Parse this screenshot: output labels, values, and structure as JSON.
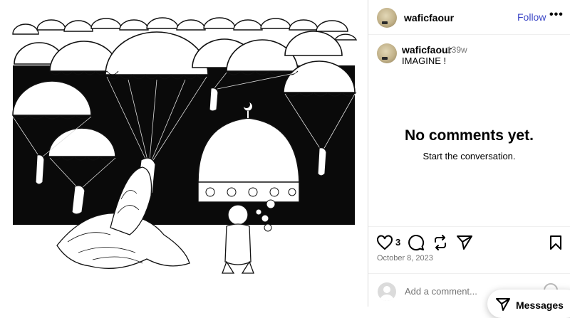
{
  "post": {
    "username": "waficfaour",
    "follow_label": "Follow",
    "more_label": "•••",
    "caption_username": "waficfaour",
    "time_ago": "139w",
    "caption_text": "IMAGINE !",
    "likes_count": "3",
    "date": "October 8, 2023",
    "image_alt": "cartoon of soldiers parachuting toward a dome while a child watches"
  },
  "comments": {
    "empty_title": "No comments yet.",
    "empty_subtitle": "Start the conversation.",
    "add_placeholder": "Add a comment..."
  },
  "messages": {
    "label": "Messages"
  },
  "colors": {
    "accent": "#3c47c7",
    "muted": "#737373",
    "border": "#dbdbdb"
  },
  "icons": [
    "heart-icon",
    "comment-icon",
    "repost-icon",
    "share-icon",
    "bookmark-icon",
    "user-icon",
    "send-icon"
  ]
}
